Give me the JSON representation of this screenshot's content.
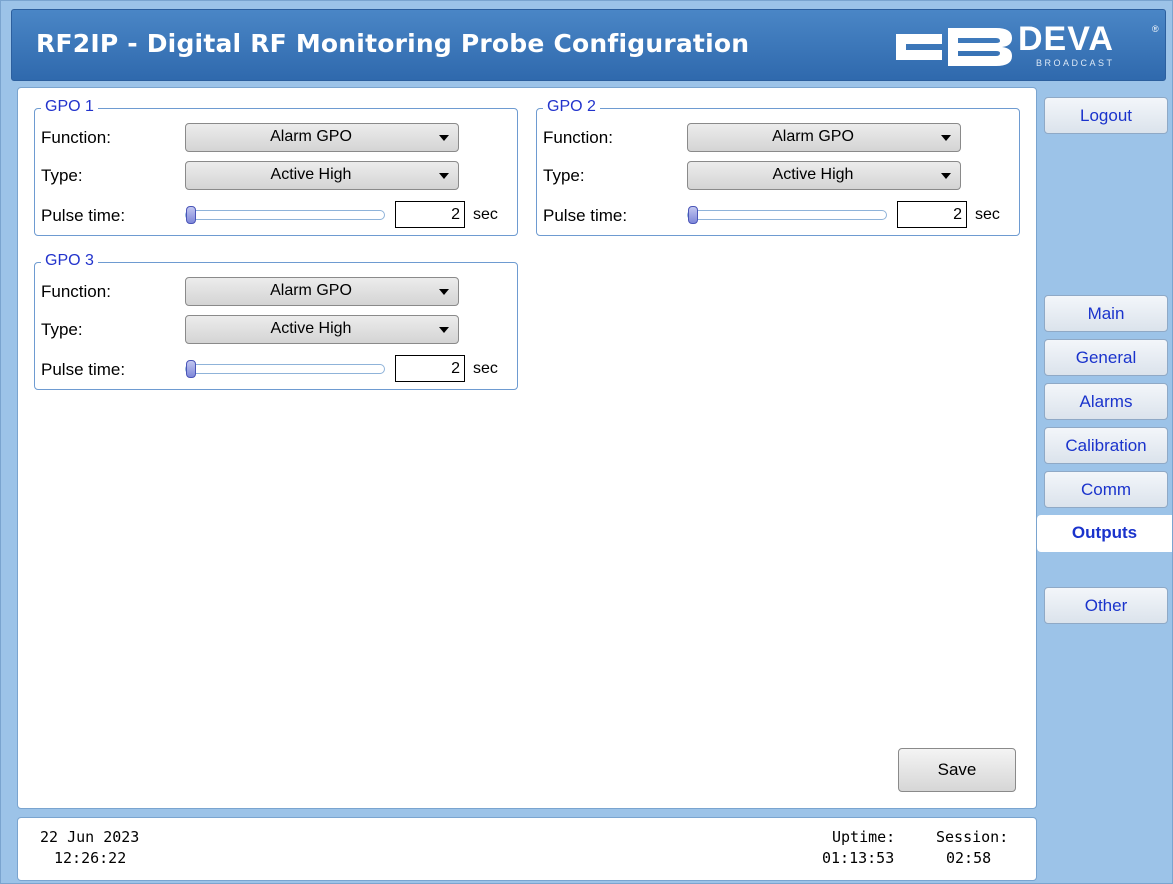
{
  "header": {
    "title": "RF2IP - Digital RF Monitoring Probe Configuration",
    "logo_text": "DEVA",
    "logo_sub": "BROADCAST",
    "logo_reg": "®"
  },
  "groups": [
    {
      "legend": "GPO 1",
      "function_label": "Function:",
      "function_value": "Alarm GPO",
      "type_label": "Type:",
      "type_value": "Active High",
      "pulse_label": "Pulse time:",
      "pulse_value": "2",
      "pulse_unit": "sec"
    },
    {
      "legend": "GPO 2",
      "function_label": "Function:",
      "function_value": "Alarm GPO",
      "type_label": "Type:",
      "type_value": "Active High",
      "pulse_label": "Pulse time:",
      "pulse_value": "2",
      "pulse_unit": "sec"
    },
    {
      "legend": "GPO 3",
      "function_label": "Function:",
      "function_value": "Alarm GPO",
      "type_label": "Type:",
      "type_value": "Active High",
      "pulse_label": "Pulse time:",
      "pulse_value": "2",
      "pulse_unit": "sec"
    }
  ],
  "save_label": "Save",
  "footer": {
    "date": "22 Jun 2023",
    "time": "12:26:22",
    "uptime_label": "Uptime:",
    "uptime_value": "01:13:53",
    "session_label": "Session:",
    "session_value": "02:58"
  },
  "nav": {
    "logout": "Logout",
    "items": [
      "Main",
      "General",
      "Alarms",
      "Calibration",
      "Comm",
      "Outputs",
      "Other"
    ],
    "active": "Outputs"
  },
  "colors": {
    "header_bg": "#3a77bb",
    "background": "#9cc3e8",
    "link_blue": "#1a33cc",
    "legend_blue": "#2233cc"
  }
}
